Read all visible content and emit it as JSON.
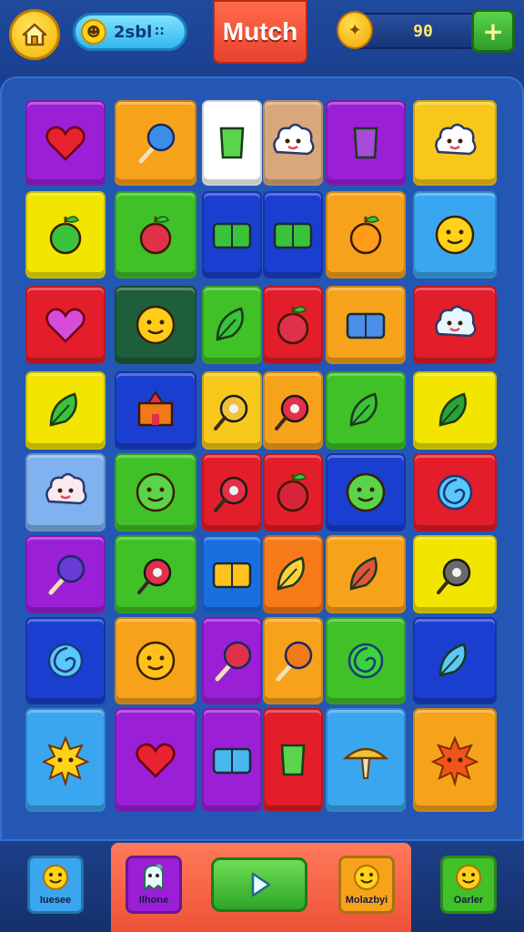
{
  "header": {
    "home_icon": "home-icon",
    "score_label": "2sbl",
    "score_suffix": "∷",
    "title": "Mutch",
    "coins_value": "90",
    "coin_icon": "coin-icon",
    "add_label": "+"
  },
  "board": {
    "columns": 8,
    "rows": 8,
    "tiles": [
      {
        "color": "#9b1fd6",
        "icon": "heart"
      },
      {
        "color": "#f7a21b",
        "icon": "lollipop"
      },
      {
        "color": "#ffffff",
        "icon": "green-cup"
      },
      {
        "color": "#d9a87a",
        "icon": "sheep"
      },
      {
        "color": "#9b1fd6",
        "icon": "bottle"
      },
      {
        "color": "#f7c81b",
        "icon": "white-cat"
      },
      {
        "color": "#f2e500",
        "icon": "apple"
      },
      {
        "color": "#3fc127",
        "icon": "strawberry-star"
      },
      {
        "color": "#1a3fd0",
        "icon": "gift-box"
      },
      {
        "color": "#1a3fd0",
        "icon": "envelope"
      },
      {
        "color": "#f7a21b",
        "icon": "orange-fruit"
      },
      {
        "color": "#3aa6ef",
        "icon": "smiley-sun"
      },
      {
        "color": "#e31d2a",
        "icon": "purple-heart"
      },
      {
        "color": "#1e5e3a",
        "icon": "smiley-face"
      },
      {
        "color": "#3fc127",
        "icon": "leaf-stick"
      },
      {
        "color": "#e31d2a",
        "icon": "cherry"
      },
      {
        "color": "#f7a21b",
        "icon": "heart-card"
      },
      {
        "color": "#e31d2a",
        "icon": "cloud"
      },
      {
        "color": "#f2e500",
        "icon": "green-leaf"
      },
      {
        "color": "#1a3fd0",
        "icon": "castle"
      },
      {
        "color": "#f7c81b",
        "icon": "ring"
      },
      {
        "color": "#f7a21b",
        "icon": "joystick"
      },
      {
        "color": "#3fc127",
        "icon": "carrot"
      },
      {
        "color": "#f2e500",
        "icon": "clover"
      },
      {
        "color": "#7fb2ee",
        "icon": "blob-face"
      },
      {
        "color": "#3fc127",
        "icon": "green-face"
      },
      {
        "color": "#e31d2a",
        "icon": "hook"
      },
      {
        "color": "#e31d2a",
        "icon": "radish"
      },
      {
        "color": "#1a3fd0",
        "icon": "green-ball"
      },
      {
        "color": "#e31d2a",
        "icon": "swirl"
      },
      {
        "color": "#9b1fd6",
        "icon": "purple-lollipop"
      },
      {
        "color": "#3fc127",
        "icon": "red-donut"
      },
      {
        "color": "#1a6fe0",
        "icon": "yellow-gift"
      },
      {
        "color": "#f77a1b",
        "icon": "bell-candy"
      },
      {
        "color": "#f7a21b",
        "icon": "arrow"
      },
      {
        "color": "#f2e500",
        "icon": "frying-pan"
      },
      {
        "color": "#1a3fd0",
        "icon": "blue-swirl"
      },
      {
        "color": "#f7a21b",
        "icon": "orange-face"
      },
      {
        "color": "#9b1fd6",
        "icon": "red-lollipop"
      },
      {
        "color": "#f7a21b",
        "icon": "orange-lollipop"
      },
      {
        "color": "#3fc127",
        "icon": "green-swirl"
      },
      {
        "color": "#1a3fd0",
        "icon": "candy-wrap"
      },
      {
        "color": "#3aa6ef",
        "icon": "sun-star"
      },
      {
        "color": "#9b1fd6",
        "icon": "red-heart-tilt"
      },
      {
        "color": "#9b1fd6",
        "icon": "controller"
      },
      {
        "color": "#e31d2a",
        "icon": "green-vase"
      },
      {
        "color": "#3aa6ef",
        "icon": "mushroom"
      },
      {
        "color": "#f7a21b",
        "icon": "orange-sun"
      }
    ]
  },
  "footer": {
    "nav": [
      {
        "label": "Iuesee",
        "color": "#3aa6ef",
        "icon": "sun-face-icon"
      },
      {
        "label": "Ilhone",
        "color": "#9b1fd6",
        "icon": "ghost-face-icon"
      },
      {
        "label": "Molazbyi",
        "color": "#f7a21b",
        "icon": "sun-face-icon"
      },
      {
        "label": "Oarler",
        "color": "#3fc127",
        "icon": "sun-face-icon"
      }
    ],
    "play_icon": "play-icon"
  }
}
